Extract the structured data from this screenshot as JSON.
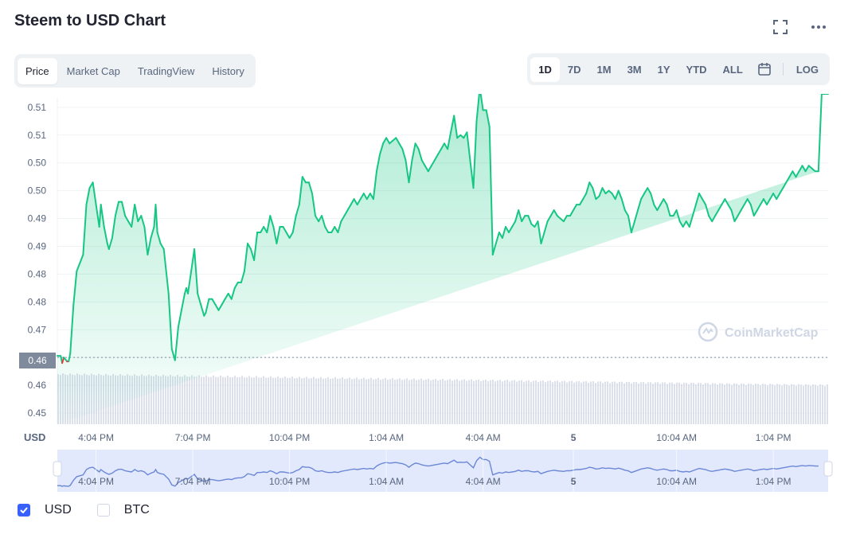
{
  "title": "Steem to USD Chart",
  "header_icons": [
    "fullscreen-icon",
    "more-icon"
  ],
  "view_tabs": [
    {
      "label": "Price",
      "active": true
    },
    {
      "label": "Market Cap",
      "active": false
    },
    {
      "label": "TradingView",
      "active": false
    },
    {
      "label": "History",
      "active": false
    }
  ],
  "range_tabs": [
    {
      "label": "1D",
      "active": true
    },
    {
      "label": "7D",
      "active": false
    },
    {
      "label": "1M",
      "active": false
    },
    {
      "label": "3M",
      "active": false
    },
    {
      "label": "1Y",
      "active": false
    },
    {
      "label": "YTD",
      "active": false
    },
    {
      "label": "ALL",
      "active": false
    }
  ],
  "log_label": "LOG",
  "legend": [
    {
      "label": "USD",
      "checked": true
    },
    {
      "label": "BTC",
      "checked": false
    }
  ],
  "colors": {
    "up": "#16c784",
    "down": "#ea3943",
    "accent": "#3861fb",
    "volume": "#cfd6e4",
    "navigator": "#dbe3fd"
  },
  "chart_data": {
    "type": "area",
    "currency_label": "USD",
    "watermark": "CoinMarketCap",
    "current_price_label": "0.46",
    "reference_price": 0.4625,
    "y_tick_labels": [
      "0.51",
      "0.51",
      "0.50",
      "0.50",
      "0.49",
      "0.49",
      "0.48",
      "0.48",
      "0.47",
      "0.46",
      "0.46",
      "0.45"
    ],
    "y_tick_values": [
      0.5075,
      0.5025,
      0.4975,
      0.4925,
      0.4875,
      0.4825,
      0.4775,
      0.4725,
      0.4675,
      0.4625,
      0.4575,
      0.4525
    ],
    "ylim": [
      0.4505,
      0.5092
    ],
    "x_tick_labels": [
      "4:04 PM",
      "7:04 PM",
      "10:04 PM",
      "1:04 AM",
      "4:04 AM",
      "5",
      "10:04 AM",
      "1:04 PM"
    ],
    "x_tick_hours": [
      1.2,
      4.2,
      7.2,
      10.2,
      13.2,
      16.0,
      19.2,
      22.2
    ],
    "x_range_hours": [
      0,
      23.9
    ],
    "series": [
      {
        "x_hours": [
          0,
          0.1,
          0.15,
          0.2,
          0.3,
          0.35,
          0.4,
          0.5,
          0.6,
          0.8,
          0.9,
          1.0,
          1.1,
          1.2,
          1.3,
          1.35,
          1.45,
          1.55,
          1.6,
          1.7,
          1.8,
          1.9,
          2.0,
          2.1,
          2.2,
          2.3,
          2.4,
          2.5,
          2.6,
          2.7,
          2.8,
          2.9,
          3.0,
          3.05,
          3.1,
          3.2,
          3.3,
          3.45,
          3.55,
          3.65,
          3.75,
          3.85,
          3.95,
          4.0,
          4.05,
          4.15,
          4.25,
          4.35,
          4.45,
          4.55,
          4.6,
          4.7,
          4.8,
          4.9,
          5.0,
          5.1,
          5.2,
          5.3,
          5.4,
          5.5,
          5.6,
          5.7,
          5.8,
          5.9,
          6.0,
          6.1,
          6.2,
          6.3,
          6.4,
          6.5,
          6.6,
          6.7,
          6.8,
          6.9,
          7.0,
          7.1,
          7.2,
          7.3,
          7.4,
          7.5,
          7.6,
          7.7,
          7.8,
          7.9,
          8.0,
          8.1,
          8.2,
          8.3,
          8.4,
          8.5,
          8.6,
          8.7,
          8.8,
          8.9,
          9.0,
          9.1,
          9.2,
          9.3,
          9.4,
          9.5,
          9.6,
          9.7,
          9.8,
          9.9,
          10.0,
          10.1,
          10.2,
          10.3,
          10.4,
          10.5,
          10.6,
          10.7,
          10.8,
          10.9,
          11.0,
          11.1,
          11.2,
          11.3,
          11.4,
          11.5,
          11.6,
          11.7,
          11.8,
          11.9,
          12.0,
          12.1,
          12.2,
          12.3,
          12.4,
          12.5,
          12.6,
          12.7,
          12.8,
          12.9,
          13.0,
          13.1,
          13.2,
          13.3,
          13.4,
          13.5,
          13.6,
          13.7,
          13.8,
          13.9,
          14.0,
          14.1,
          14.2,
          14.3,
          14.4,
          14.5,
          14.6,
          14.7,
          14.8,
          14.9,
          15.0,
          15.1,
          15.2,
          15.3,
          15.4,
          15.5,
          15.6,
          15.7,
          15.8,
          15.9,
          16.0,
          16.1,
          16.2,
          16.3,
          16.4,
          16.5,
          16.6,
          16.7,
          16.8,
          16.9,
          17.0,
          17.1,
          17.2,
          17.3,
          17.4,
          17.5,
          17.6,
          17.7,
          17.8,
          17.9,
          18.0,
          18.1,
          18.2,
          18.3,
          18.4,
          18.5,
          18.6,
          18.7,
          18.8,
          18.9,
          19.0,
          19.1,
          19.2,
          19.3,
          19.4,
          19.5,
          19.6,
          19.7,
          19.8,
          19.9,
          20.0,
          20.1,
          20.2,
          20.3,
          20.4,
          20.5,
          20.6,
          20.7,
          20.8,
          20.9,
          21.0,
          21.1,
          21.2,
          21.3,
          21.4,
          21.5,
          21.6,
          21.7,
          21.8,
          21.9,
          22.0,
          22.1,
          22.2,
          22.3,
          22.4,
          22.5,
          22.6,
          22.7,
          22.8,
          22.9,
          23.0,
          23.1,
          23.2,
          23.3,
          23.4,
          23.5,
          23.6,
          23.7,
          23.8,
          23.9
        ],
        "values": [
          0.4628,
          0.4628,
          0.4615,
          0.4625,
          0.4618,
          0.4618,
          0.4632,
          0.472,
          0.478,
          0.481,
          0.49,
          0.493,
          0.494,
          0.49,
          0.486,
          0.49,
          0.486,
          0.483,
          0.482,
          0.484,
          0.488,
          0.4905,
          0.4905,
          0.488,
          0.487,
          0.486,
          0.49,
          0.487,
          0.488,
          0.486,
          0.481,
          0.484,
          0.486,
          0.49,
          0.485,
          0.483,
          0.482,
          0.474,
          0.464,
          0.462,
          0.468,
          0.471,
          0.474,
          0.475,
          0.474,
          0.478,
          0.482,
          0.474,
          0.472,
          0.47,
          0.4705,
          0.473,
          0.473,
          0.472,
          0.471,
          0.472,
          0.473,
          0.474,
          0.473,
          0.475,
          0.476,
          0.476,
          0.478,
          0.483,
          0.482,
          0.48,
          0.485,
          0.485,
          0.486,
          0.485,
          0.488,
          0.486,
          0.483,
          0.486,
          0.486,
          0.485,
          0.484,
          0.485,
          0.488,
          0.49,
          0.495,
          0.494,
          0.494,
          0.492,
          0.488,
          0.487,
          0.488,
          0.486,
          0.485,
          0.485,
          0.486,
          0.485,
          0.487,
          0.488,
          0.489,
          0.49,
          0.491,
          0.49,
          0.491,
          0.492,
          0.491,
          0.492,
          0.491,
          0.496,
          0.499,
          0.501,
          0.502,
          0.501,
          0.5015,
          0.502,
          0.501,
          0.5,
          0.498,
          0.494,
          0.498,
          0.501,
          0.5,
          0.498,
          0.497,
          0.496,
          0.497,
          0.498,
          0.499,
          0.5,
          0.501,
          0.5,
          0.503,
          0.506,
          0.502,
          0.5025,
          0.502,
          0.503,
          0.498,
          0.493,
          0.505,
          0.511,
          0.507,
          0.507,
          0.504,
          0.481,
          0.483,
          0.485,
          0.484,
          0.486,
          0.485,
          0.486,
          0.487,
          0.489,
          0.487,
          0.488,
          0.488,
          0.4865,
          0.486,
          0.487,
          0.483,
          0.485,
          0.487,
          0.488,
          0.489,
          0.488,
          0.4875,
          0.487,
          0.488,
          0.488,
          0.489,
          0.49,
          0.49,
          0.491,
          0.492,
          0.494,
          0.493,
          0.491,
          0.4915,
          0.493,
          0.492,
          0.4925,
          0.492,
          0.491,
          0.4925,
          0.491,
          0.489,
          0.488,
          0.485,
          0.487,
          0.489,
          0.491,
          0.492,
          0.493,
          0.492,
          0.49,
          0.489,
          0.49,
          0.491,
          0.49,
          0.488,
          0.488,
          0.489,
          0.487,
          0.486,
          0.487,
          0.486,
          0.488,
          0.49,
          0.492,
          0.491,
          0.49,
          0.488,
          0.487,
          0.488,
          0.489,
          0.49,
          0.491,
          0.49,
          0.489,
          0.487,
          0.488,
          0.489,
          0.49,
          0.491,
          0.49,
          0.488,
          0.489,
          0.49,
          0.491,
          0.49,
          0.491,
          0.492,
          0.491,
          0.492,
          0.493,
          0.494,
          0.495,
          0.496,
          0.495,
          0.496,
          0.497,
          0.496,
          0.497,
          0.4965,
          0.496,
          0.496
        ]
      }
    ],
    "grid": true,
    "navigator": true,
    "volume_bars": true
  }
}
